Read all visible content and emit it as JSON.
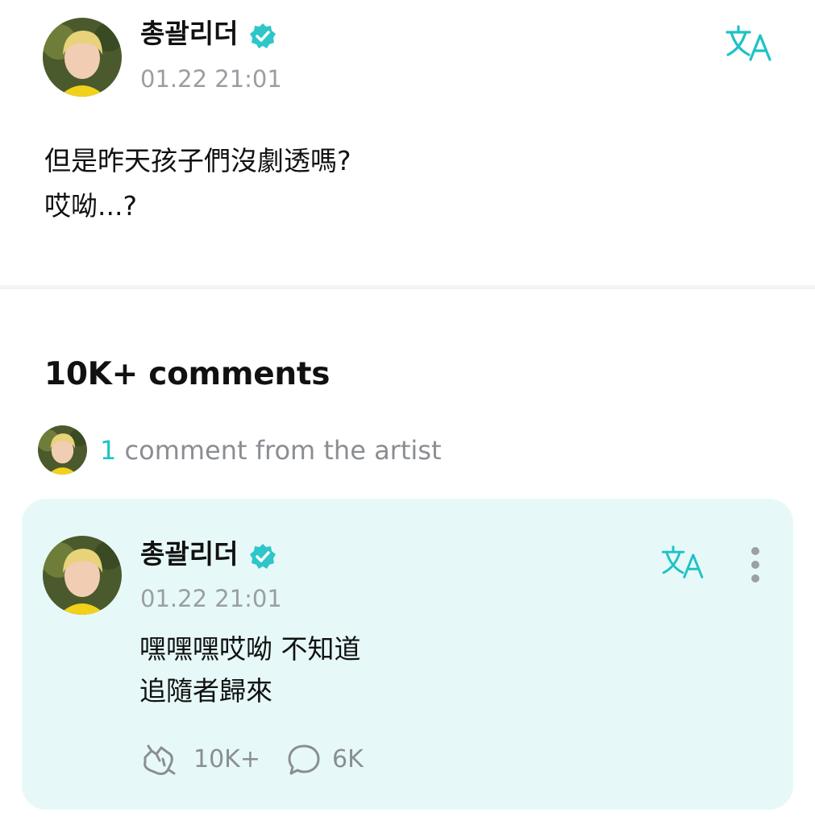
{
  "post": {
    "author": "총괄리더",
    "timestamp": "01.22 21:01",
    "body_lines": [
      "但是昨天孩子們沒劇透嗎?",
      "哎呦...?"
    ]
  },
  "comments": {
    "header": "10K+ comments",
    "artist_count": "1",
    "artist_label": " comment from the artist"
  },
  "comment": {
    "author": "총괄리더",
    "timestamp": "01.22 21:01",
    "body_lines": [
      "嘿嘿嘿哎呦 不知道",
      "追隨者歸來"
    ],
    "likes": "10K+",
    "replies": "6K"
  },
  "icons": {
    "verified": "verified-badge-icon",
    "translate": "translate-icon",
    "more": "more-vertical-icon",
    "like": "like-hand-icon",
    "reply": "comment-bubble-icon"
  },
  "colors": {
    "accent": "#1fc2c6",
    "card_background": "#e6f9f8",
    "muted_text": "#8a8e93"
  }
}
